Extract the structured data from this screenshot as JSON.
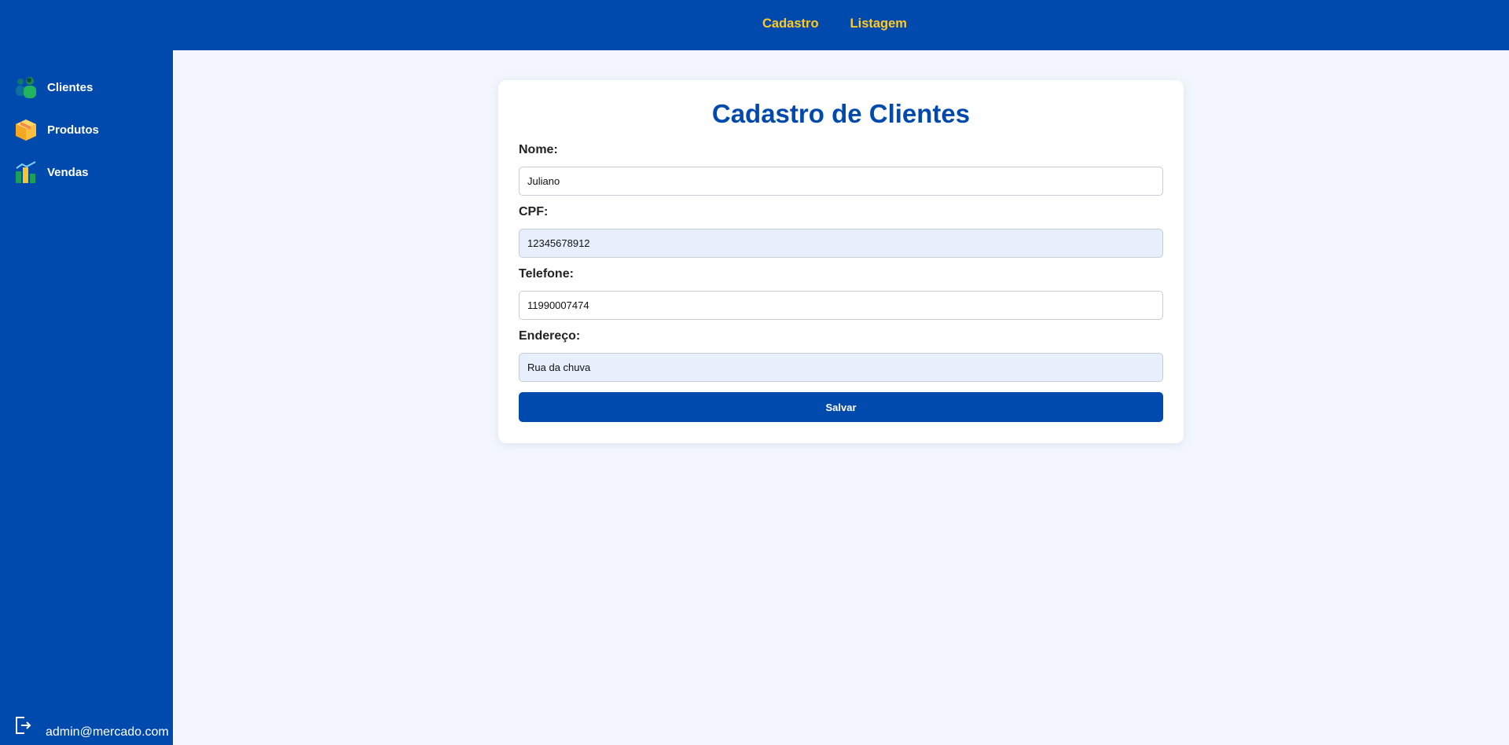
{
  "topnav": {
    "items": [
      {
        "label": "Cadastro"
      },
      {
        "label": "Listagem"
      }
    ],
    "link_color": "#ffc928"
  },
  "sidebar": {
    "items": [
      {
        "label": "Clientes",
        "icon": "users-icon"
      },
      {
        "label": "Produtos",
        "icon": "box-icon"
      },
      {
        "label": "Vendas",
        "icon": "bar-chart-icon"
      }
    ],
    "logout_icon": "logout-icon",
    "user_email": "admin@mercado.com"
  },
  "form": {
    "title": "Cadastro de Clientes",
    "fields": [
      {
        "label": "Nome:",
        "value": "Juliano"
      },
      {
        "label": "CPF:",
        "value": "12345678912"
      },
      {
        "label": "Telefone:",
        "value": "11990007474"
      },
      {
        "label": "Endereço:",
        "value": "Rua da chuva"
      }
    ],
    "save_label": "Salvar"
  },
  "colors": {
    "primary": "#0049ad",
    "accent": "#ffc928",
    "background": "#f3f7fd",
    "autofill": "#e7effc"
  }
}
